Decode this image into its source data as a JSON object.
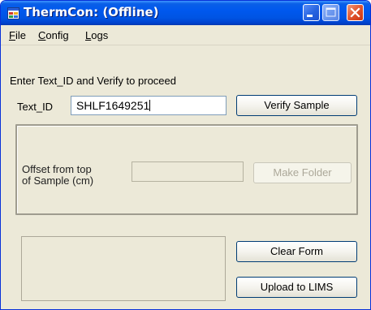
{
  "window": {
    "title": "ThermCon: (Offline)"
  },
  "menu": {
    "items": [
      {
        "label": "File"
      },
      {
        "label": "Config"
      },
      {
        "label": "Logs"
      }
    ]
  },
  "form": {
    "instruction": "Enter Text_ID and Verify to proceed",
    "text_id_label": "Text_ID",
    "text_id_value": "SHLF1649251",
    "verify_button": "Verify Sample",
    "offset_label_line1": "Offset from top",
    "offset_label_line2": "of Sample (cm)",
    "offset_value": "",
    "make_folder_button": "Make Folder",
    "clear_button": "Clear Form",
    "upload_button": "Upload to LIMS"
  },
  "colors": {
    "titlebar": "#0054e3",
    "window_bg": "#ece9d8",
    "input_border": "#7f9db9",
    "button_border": "#003c74",
    "disabled_text": "#aca899"
  },
  "icons": {
    "app": "app-window-icon",
    "minimize": "minimize-icon",
    "maximize": "maximize-icon",
    "close": "close-icon"
  }
}
